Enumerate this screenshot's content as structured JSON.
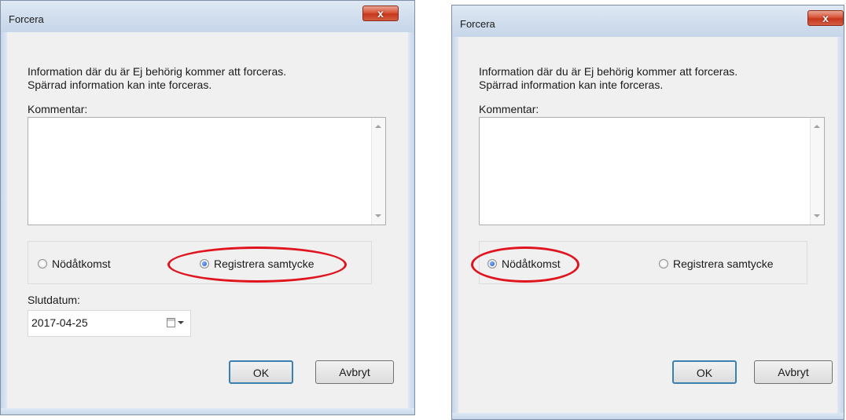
{
  "dialogs": [
    {
      "title": "Forcera",
      "close_label": "x",
      "info_line1": "Information där du är Ej behörig kommer att forceras.",
      "info_line2": "Spärrad information kan inte forceras.",
      "comment_label": "Kommentar:",
      "comment_value": "",
      "radio_emergency_label": "Nödåtkomst",
      "radio_consent_label": "Registrera samtycke",
      "selected": "consent",
      "end_date_label": "Slutdatum:",
      "end_date_value": "2017-04-25",
      "ok_label": "OK",
      "cancel_label": "Avbryt"
    },
    {
      "title": "Forcera",
      "close_label": "x",
      "info_line1": "Information där du är Ej behörig kommer att forceras.",
      "info_line2": "Spärrad information kan inte forceras.",
      "comment_label": "Kommentar:",
      "comment_value": "",
      "radio_emergency_label": "Nödåtkomst",
      "radio_consent_label": "Registrera samtycke",
      "selected": "emergency",
      "ok_label": "OK",
      "cancel_label": "Avbryt"
    }
  ],
  "colors": {
    "highlight": "#e0141e",
    "close_button": "#c7371c",
    "titlebar": "#cfdcec"
  },
  "icons": [
    "close-icon",
    "scroll-up-icon",
    "scroll-down-icon",
    "calendar-icon",
    "chevron-down-icon"
  ]
}
